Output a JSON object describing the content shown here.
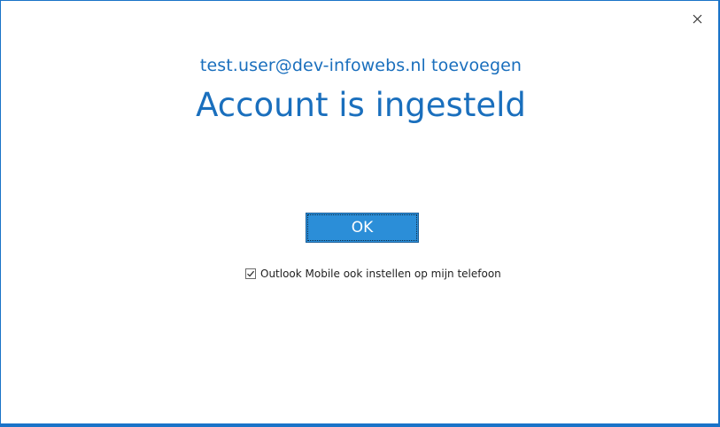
{
  "dialog": {
    "subtitle": "test.user@dev-infowebs.nl toevoegen",
    "title": "Account is ingesteld",
    "ok_label": "OK",
    "checkbox_label": "Outlook Mobile ook instellen op mijn telefoon",
    "checkbox_checked": true,
    "close_icon": "close-icon"
  },
  "colors": {
    "accent": "#1a6fbd",
    "button_bg": "#2b8ed8",
    "window_border": "#1a73c8"
  }
}
